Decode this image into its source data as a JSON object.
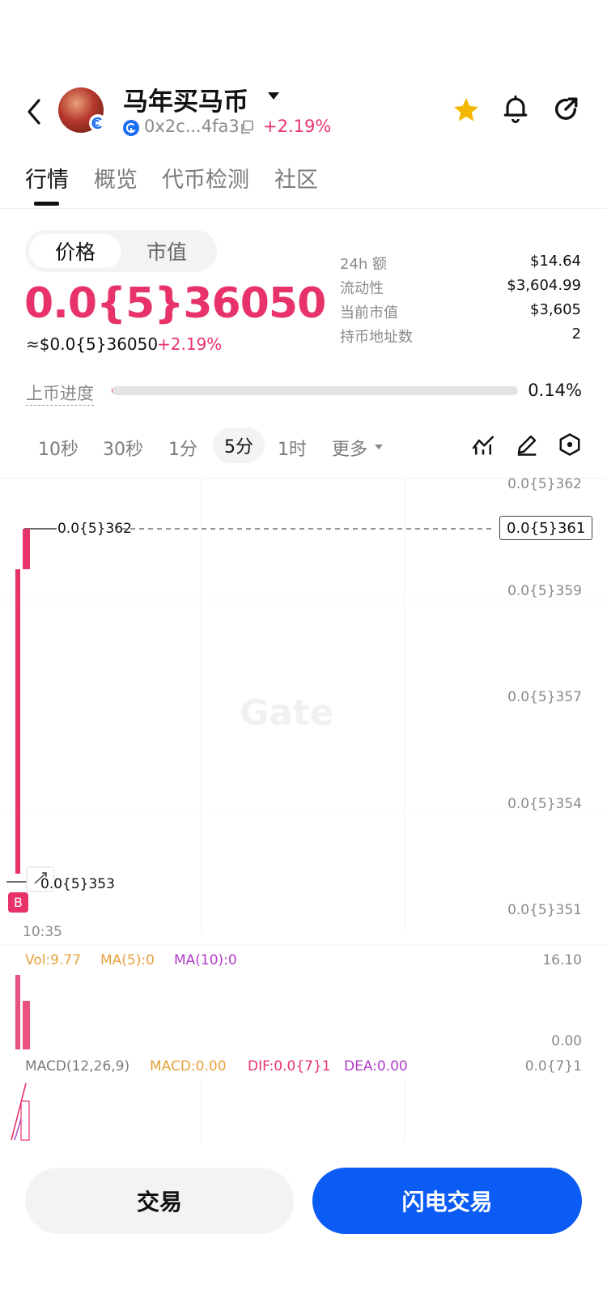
{
  "header": {
    "title": "马年买马币",
    "address": "0x2c...4fa3",
    "change": "+2.19%"
  },
  "tabs": [
    {
      "label": "行情"
    },
    {
      "label": "概览"
    },
    {
      "label": "代币检测"
    },
    {
      "label": "社区"
    }
  ],
  "price_toggle": {
    "price": "价格",
    "market_cap": "市值"
  },
  "price": {
    "value": "0.0{5}36050",
    "usd": "≈$0.0{5}36050",
    "change": "+2.19%"
  },
  "stats": [
    {
      "label": "24h  额",
      "value": "$14.64"
    },
    {
      "label": "流动性",
      "value": "$3,604.99"
    },
    {
      "label": "当前市值",
      "value": "$3,605"
    },
    {
      "label": "持币地址数",
      "value": "2"
    }
  ],
  "progress": {
    "label": "上币进度",
    "value": "0.14%",
    "fraction": 0.0014
  },
  "intervals": [
    "10秒",
    "30秒",
    "1分",
    "5分",
    "1时",
    "更多"
  ],
  "selected_interval": "5分",
  "chart": {
    "y_axis": [
      "0.0{5}362",
      "0.0{5}359",
      "0.0{5}357",
      "0.0{5}354",
      "0.0{5}351"
    ],
    "current_price_tag": "0.0{5}361",
    "high_label": "0.0{5}362",
    "low_label": "0.0{5}353",
    "time": "10:35",
    "buy_marker": "B",
    "watermark": "Gate"
  },
  "volume": {
    "vol": "Vol:9.77",
    "ma5": "MA(5):0",
    "ma10": "MA(10):0",
    "axis_top": "16.10",
    "axis_bottom": "0.00"
  },
  "macd": {
    "label": "MACD(12,26,9)",
    "macd": "MACD:0.00",
    "dif": "DIF:0.0{7}1",
    "dea": "DEA:0.00",
    "axis_top": "0.0{7}1"
  },
  "buttons": {
    "trade": "交易",
    "flash_trade": "闪电交易"
  },
  "colors": {
    "up": "#e8336a",
    "primary": "#0a5cf5",
    "star": "#f5b800"
  }
}
